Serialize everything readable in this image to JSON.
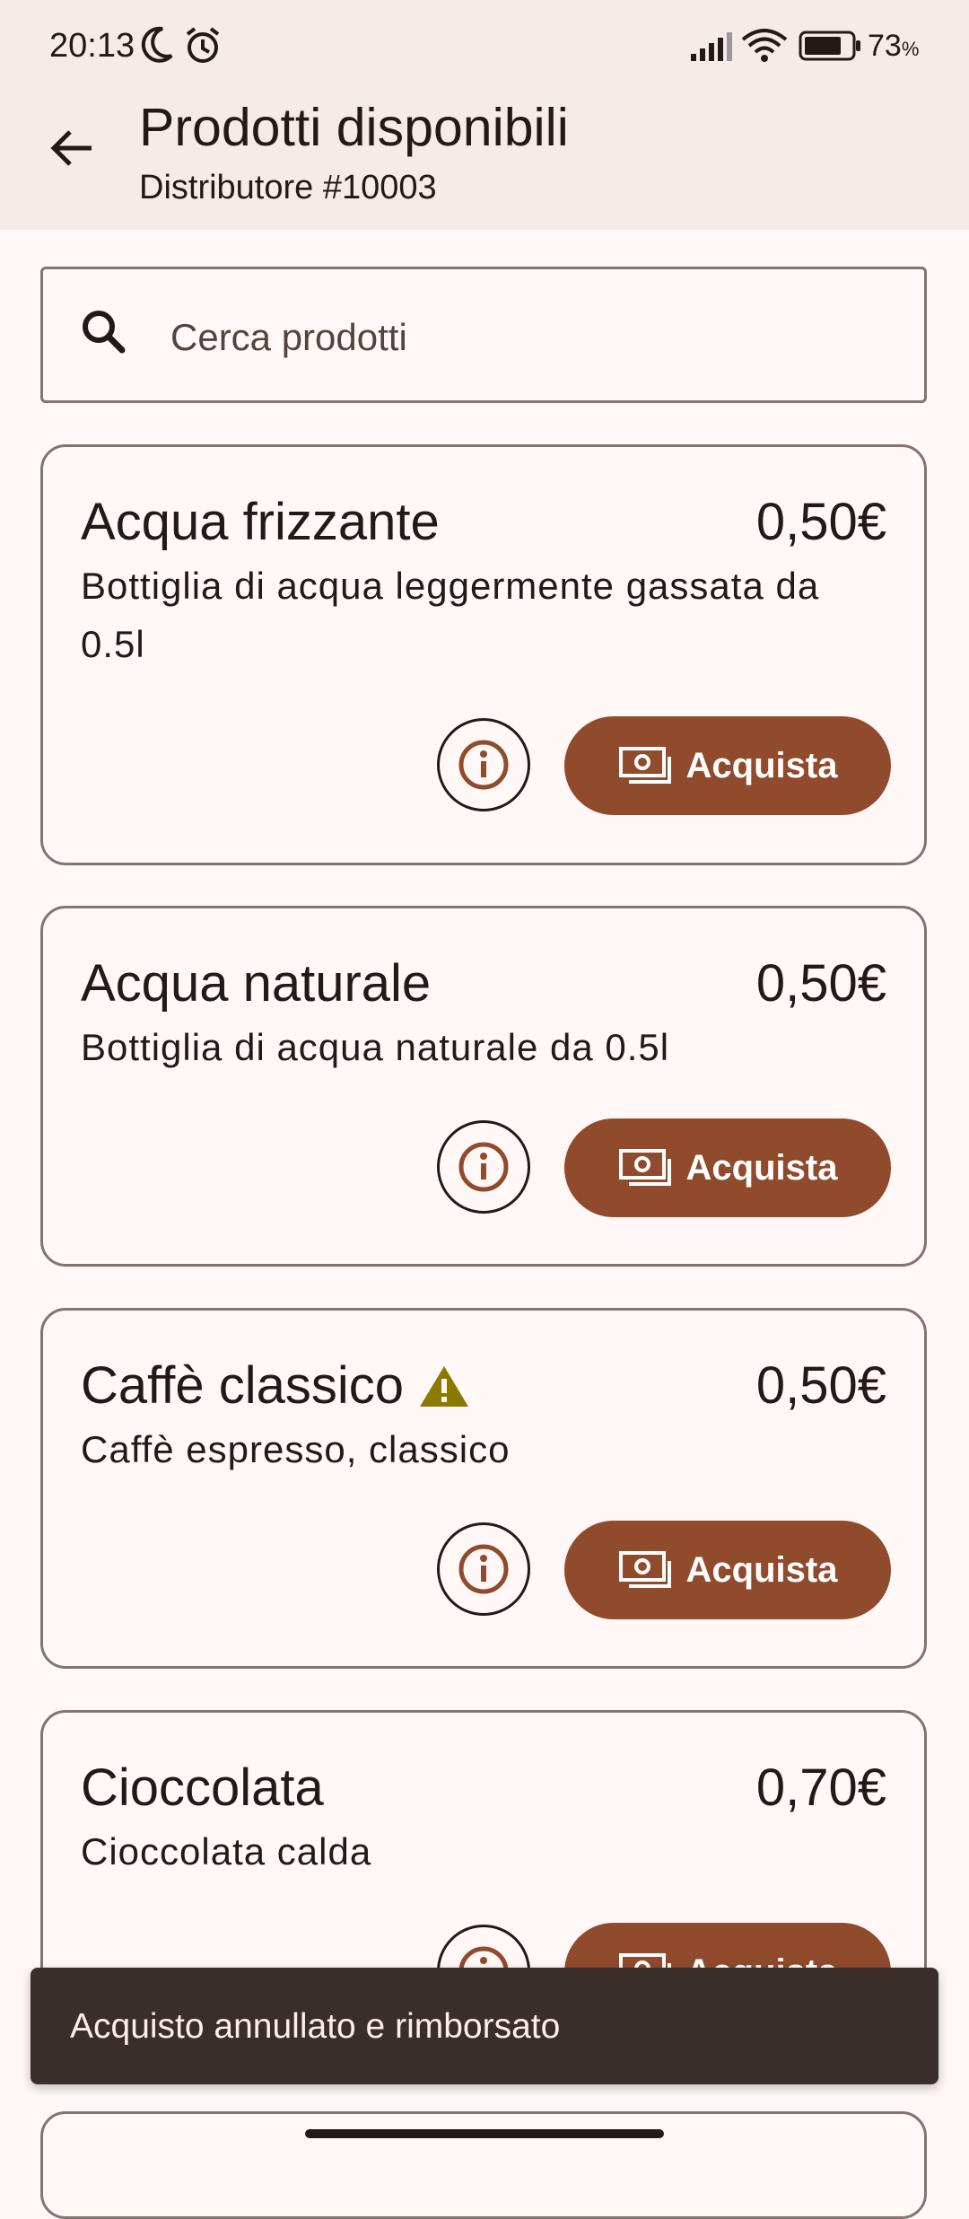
{
  "status_bar": {
    "time": "20:13",
    "battery_percent": "73",
    "battery_suffix": "%",
    "icons": [
      "moon-icon",
      "alarm-icon",
      "signal-icon",
      "wifi-icon",
      "battery-icon"
    ]
  },
  "app_bar": {
    "title": "Prodotti disponibili",
    "subtitle": "Distributore #10003",
    "back_icon": "arrow-back-icon"
  },
  "search": {
    "placeholder": "Cerca prodotti",
    "value": ""
  },
  "products": [
    {
      "name": "Acqua frizzante",
      "price": "0,50€",
      "description": "Bottiglia di acqua leggermente gassata da 0.5l",
      "warning": false,
      "buy_label": "Acquista"
    },
    {
      "name": "Acqua naturale",
      "price": "0,50€",
      "description": "Bottiglia di acqua naturale da 0.5l",
      "warning": false,
      "buy_label": "Acquista"
    },
    {
      "name": "Caffè classico",
      "price": "0,50€",
      "description": "Caffè espresso, classico",
      "warning": true,
      "buy_label": "Acquista"
    },
    {
      "name": "Cioccolata",
      "price": "0,70€",
      "description": "Cioccolata calda",
      "warning": false,
      "buy_label": "Acquista"
    }
  ],
  "snackbar": {
    "message": "Acquisto annullato e rimborsato"
  },
  "colors": {
    "primary": "#904A2C",
    "surface": "#FFF8F6",
    "app_bar": "#F7EBE8",
    "outline": "#857370",
    "warning": "#8A7A00",
    "snackbar": "#392E2B"
  }
}
